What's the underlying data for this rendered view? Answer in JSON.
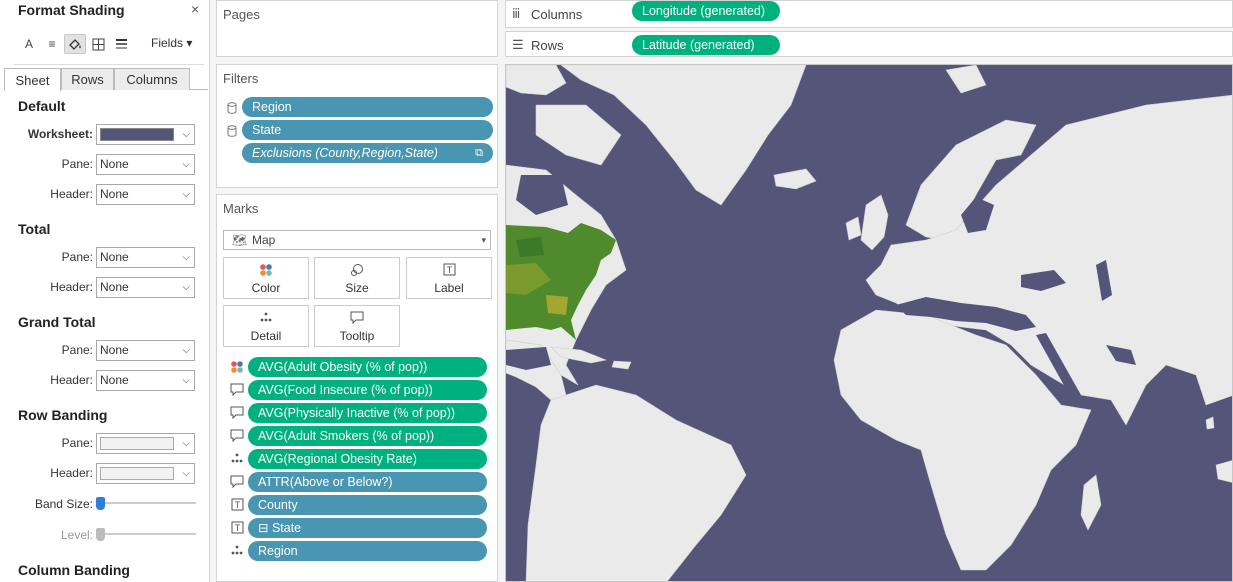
{
  "format_pane": {
    "title": "Format Shading",
    "close": "×",
    "toolbar": {
      "fields_label": "Fields ▾"
    },
    "tabs": [
      "Sheet",
      "Rows",
      "Columns"
    ],
    "default": {
      "heading": "Default",
      "worksheet_label": "Worksheet:",
      "worksheet_color": "#555479",
      "pane_label": "Pane:",
      "pane_value": "None",
      "header_label": "Header:",
      "header_value": "None"
    },
    "total": {
      "heading": "Total",
      "pane_label": "Pane:",
      "pane_value": "None",
      "header_label": "Header:",
      "header_value": "None"
    },
    "grand_total": {
      "heading": "Grand Total",
      "pane_label": "Pane:",
      "pane_value": "None",
      "header_label": "Header:",
      "header_value": "None"
    },
    "row_banding": {
      "heading": "Row Banding",
      "pane_label": "Pane:",
      "header_label": "Header:",
      "band_size_label": "Band Size:",
      "level_label": "Level:"
    },
    "column_banding": {
      "heading": "Column Banding"
    }
  },
  "pages": {
    "title": "Pages"
  },
  "filters": {
    "title": "Filters",
    "items": [
      "Region",
      "State",
      "Exclusions (County,Region,State)"
    ]
  },
  "marks": {
    "title": "Marks",
    "type": "Map",
    "buttons": [
      "Color",
      "Size",
      "Label",
      "Detail",
      "Tooltip"
    ],
    "fields": [
      {
        "label": "AVG(Adult Obesity (% of pop))",
        "icon": "color-icon",
        "kind": "measure"
      },
      {
        "label": "AVG(Food Insecure (% of pop))",
        "icon": "tooltip-icon",
        "kind": "measure"
      },
      {
        "label": "AVG(Physically Inactive (% of pop))",
        "icon": "tooltip-icon",
        "kind": "measure"
      },
      {
        "label": "AVG(Adult Smokers (% of pop))",
        "icon": "tooltip-icon",
        "kind": "measure"
      },
      {
        "label": "AVG(Regional Obesity Rate)",
        "icon": "detail-icon",
        "kind": "measure"
      },
      {
        "label": "ATTR(Above or Below?)",
        "icon": "tooltip-icon",
        "kind": "dimension"
      },
      {
        "label": "County",
        "icon": "label-icon",
        "kind": "dimension"
      },
      {
        "label": "⊟  State",
        "icon": "label-icon",
        "kind": "dimension"
      },
      {
        "label": "Region",
        "icon": "detail-icon",
        "kind": "dimension"
      }
    ]
  },
  "columns_shelf": {
    "label": "Columns",
    "pill": "Longitude (generated)"
  },
  "rows_shelf": {
    "label": "Rows",
    "pill": "Latitude (generated)"
  },
  "colors": {
    "map_water": "#555479",
    "land": "#eaeaea",
    "measure_pill": "#00b180",
    "dimension_pill": "#4996b2",
    "choropleth": "#4f8a2c"
  }
}
